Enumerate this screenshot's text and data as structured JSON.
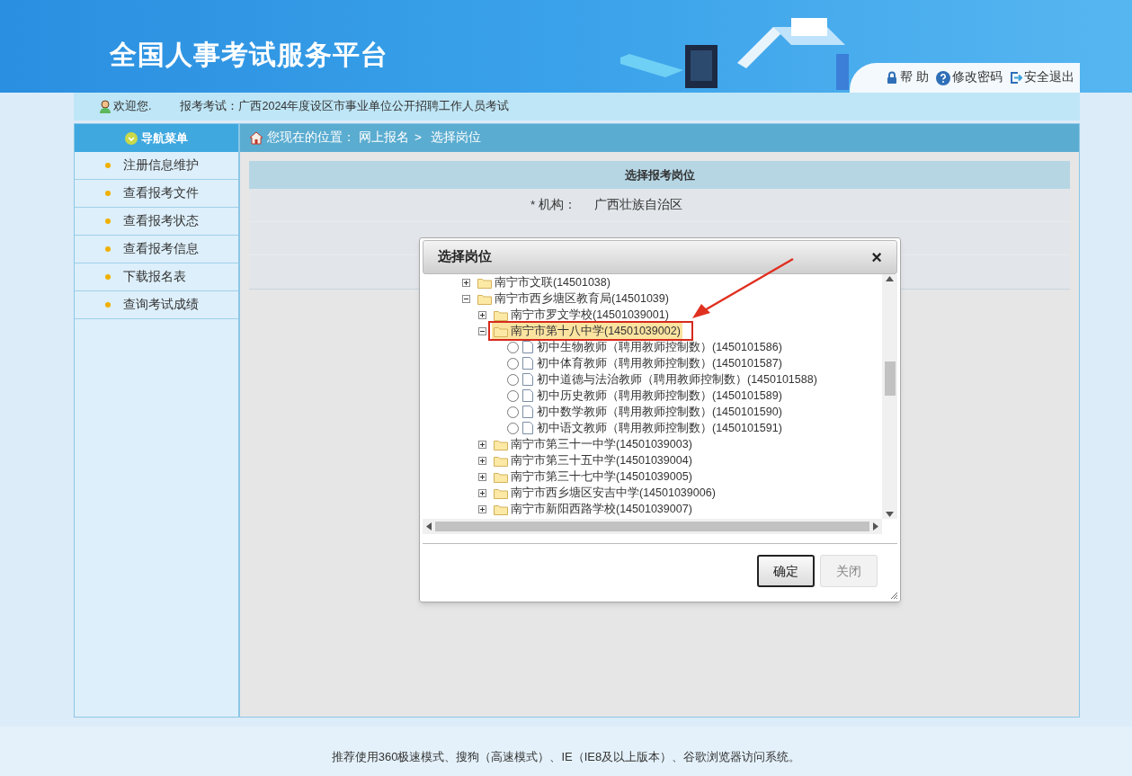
{
  "header": {
    "title": "全国人事考试服务平台",
    "links": [
      {
        "kind": "lock",
        "label": "帮 助"
      },
      {
        "kind": "help",
        "label": "修改密码"
      },
      {
        "kind": "exit",
        "label": "安全退出"
      }
    ]
  },
  "welcome_bar": {
    "greeting": "欢迎您.",
    "exam": "报考考试：广西2024年度设区市事业单位公开招聘工作人员考试"
  },
  "sidebar": {
    "title": "导航菜单",
    "items": [
      "注册信息维护",
      "查看报考文件",
      "查看报考状态",
      "查看报考信息",
      "下载报名表",
      "查询考试成绩"
    ]
  },
  "breadcrumb": {
    "label": "您现在的位置：",
    "path": [
      "网上报名",
      "选择岗位"
    ],
    "separator": ">"
  },
  "form": {
    "title": "选择报考岗位",
    "rows": [
      {
        "label": "* 机构：",
        "value": "广西壮族自治区"
      }
    ]
  },
  "dialog": {
    "title": "选择岗位",
    "close": "×",
    "tree": [
      {
        "kind": "folder",
        "label": "南宁市文联(14501038)",
        "expanded": false,
        "selected": false
      },
      {
        "kind": "folder",
        "label": "南宁市西乡塘区教育局(14501039)",
        "expanded": true,
        "selected": false,
        "children": [
          {
            "kind": "folder",
            "label": "南宁市罗文学校(14501039001)",
            "expanded": false,
            "selected": false
          },
          {
            "kind": "folder",
            "label": "南宁市第十八中学(14501039002)",
            "expanded": true,
            "selected": true,
            "annotated": true,
            "children": [
              {
                "kind": "position",
                "label": "初中生物教师（聘用教师控制数）(1450101586)",
                "checked": false
              },
              {
                "kind": "position",
                "label": "初中体育教师（聘用教师控制数）(1450101587)",
                "checked": false
              },
              {
                "kind": "position",
                "label": "初中道德与法治教师（聘用教师控制数）(1450101588)",
                "checked": false
              },
              {
                "kind": "position",
                "label": "初中历史教师（聘用教师控制数）(1450101589)",
                "checked": false
              },
              {
                "kind": "position",
                "label": "初中数学教师（聘用教师控制数）(1450101590)",
                "checked": false
              },
              {
                "kind": "position",
                "label": "初中语文教师（聘用教师控制数）(1450101591)",
                "checked": false
              }
            ]
          },
          {
            "kind": "folder",
            "label": "南宁市第三十一中学(14501039003)",
            "expanded": false,
            "selected": false
          },
          {
            "kind": "folder",
            "label": "南宁市第三十五中学(14501039004)",
            "expanded": false,
            "selected": false
          },
          {
            "kind": "folder",
            "label": "南宁市第三十七中学(14501039005)",
            "expanded": false,
            "selected": false
          },
          {
            "kind": "folder",
            "label": "南宁市西乡塘区安吉中学(14501039006)",
            "expanded": false,
            "selected": false
          },
          {
            "kind": "folder",
            "label": "南宁市新阳西路学校(14501039007)",
            "expanded": false,
            "selected": false
          }
        ]
      }
    ],
    "buttons": [
      {
        "label": "确定",
        "disabled": false
      },
      {
        "label": "关闭",
        "disabled": true
      }
    ]
  },
  "footer": "推荐使用360极速模式、搜狗（高速模式）、IE（IE8及以上版本）、谷歌浏览器访问系统。"
}
